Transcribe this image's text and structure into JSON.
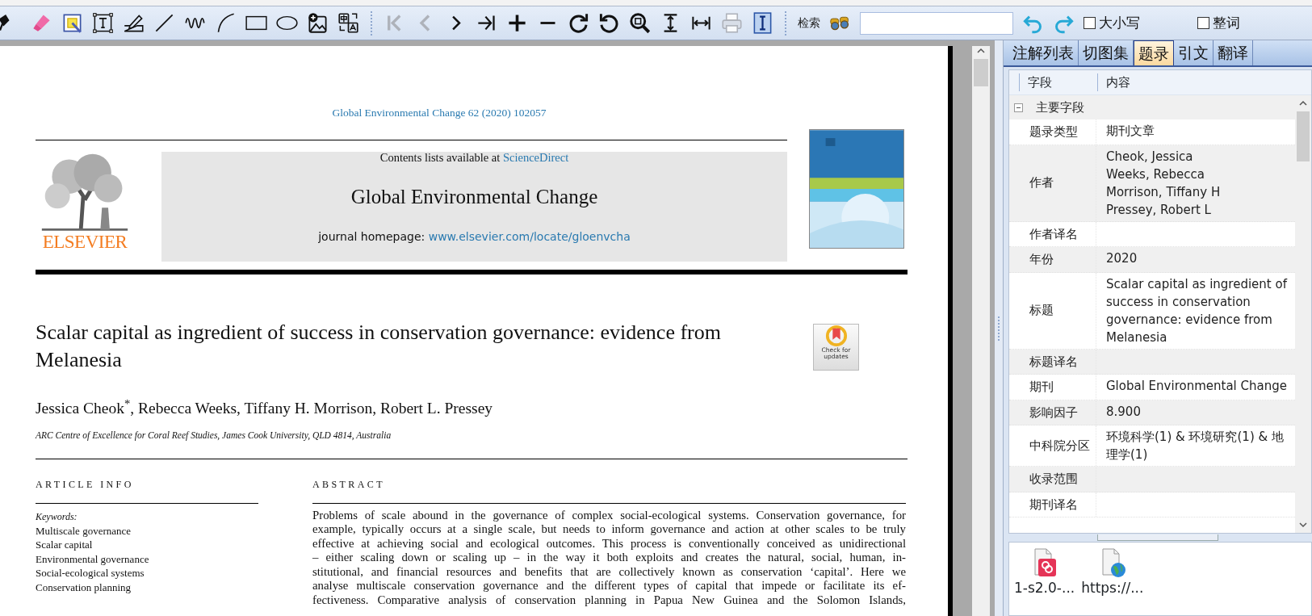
{
  "toolbar": {
    "tools": [
      {
        "kind": "pin",
        "disabled": false
      },
      {
        "kind": "highlighter",
        "disabled": false
      },
      {
        "kind": "note",
        "disabled": false
      },
      {
        "kind": "textbox",
        "disabled": false
      },
      {
        "kind": "signature",
        "disabled": false
      },
      {
        "kind": "line",
        "disabled": false
      },
      {
        "kind": "wave",
        "disabled": false
      },
      {
        "kind": "curve",
        "disabled": false
      },
      {
        "kind": "rect",
        "disabled": false
      },
      {
        "kind": "ellipse",
        "disabled": false
      },
      {
        "kind": "image_add",
        "disabled": false
      },
      {
        "kind": "translate",
        "disabled": false
      },
      {
        "kind": "separator"
      },
      {
        "kind": "first",
        "disabled": true
      },
      {
        "kind": "prev",
        "disabled": true
      },
      {
        "kind": "next",
        "disabled": false
      },
      {
        "kind": "last",
        "disabled": false
      },
      {
        "kind": "zoom_in",
        "disabled": false
      },
      {
        "kind": "zoom_out",
        "disabled": false
      },
      {
        "kind": "rotate_cw",
        "disabled": false
      },
      {
        "kind": "rotate_ccw",
        "disabled": false
      },
      {
        "kind": "zoom_fit",
        "disabled": false
      },
      {
        "kind": "fit_height",
        "disabled": false
      },
      {
        "kind": "fit_width",
        "disabled": false
      },
      {
        "kind": "print",
        "disabled": true
      },
      {
        "kind": "text_select",
        "disabled": false
      },
      {
        "kind": "separator"
      }
    ],
    "search_label": "检索",
    "options": [
      {
        "label": "大小写",
        "checked": false
      },
      {
        "label": "整词",
        "checked": false
      }
    ]
  },
  "document": {
    "citation": "Global Environmental Change 62 (2020) 102057",
    "contents_text": "Contents lists available at",
    "contents_link": "ScienceDirect",
    "journal": "Global Environmental Change",
    "homepage_label": "journal homepage:",
    "homepage_url": "www.elsevier.com/locate/gloenvcha",
    "publisher": "ELSEVIER",
    "badge": "Check for updates",
    "title": "Scalar capital as ingredient of success in conservation governance: evidence from Melanesia",
    "authors": "Jessica Cheok$^{*}$, Rebecca Weeks, Tiffany H. Morrison, Robert L. Pressey",
    "affiliation": "ARC Centre of Excellence for Coral Reef Studies, James Cook University, QLD 4814, Australia",
    "info_heading": "ARTICLE INFO",
    "keywords_label": "Keywords:",
    "keywords": [
      "Multiscale governance",
      "Scalar capital",
      "Environmental governance",
      "Social-ecological systems",
      "Conservation planning"
    ],
    "abstract_heading": "ABSTRACT",
    "abstract_lines": [
      "Problems of scale abound in the governance of complex social-ecological systems. Conservation governance, for",
      "example, typically occurs at a single scale, but needs to inform governance and action at other scales to be truly",
      "effective at achieving social and ecological outcomes. This process is conventionally conceived as unidirectional",
      "– either scaling down or scaling up – in the way it both exploits and creates the natural, social, human, in-",
      "stitutional, and financial resources and benefits that are collectively known as conservation ‘capital’. Here we",
      "analyse multiscale conservation governance and the different types of capital that impede or facilitate its ef-",
      "fectiveness. Comparative analysis of conservation planning in Papua New Guinea and the Solomon Islands,"
    ]
  },
  "panel": {
    "tabs": [
      {
        "label": "注解列表",
        "selected": false
      },
      {
        "label": "切图集",
        "selected": false
      },
      {
        "label": "题录",
        "selected": true
      },
      {
        "label": "引文",
        "selected": false
      },
      {
        "label": "翻译",
        "selected": false
      }
    ],
    "columns": [
      "字段",
      "内容"
    ],
    "groups": [
      {
        "label": "主要字段",
        "expanded": true,
        "rows": [
          {
            "field": "题录类型",
            "value": "期刊文章"
          },
          {
            "field": "作者",
            "value": "Cheok, Jessica\nWeeks, Rebecca\nMorrison, Tiffany H\nPressey, Robert L"
          },
          {
            "field": "作者译名"
          },
          {
            "field": "年份",
            "value": "2020"
          },
          {
            "field": "标题",
            "value": "Scalar capital as ingredient of success in conservation governance: evidence from Melanesia"
          },
          {
            "field": "标题译名"
          },
          {
            "field": "期刊",
            "value": "Global Environmental Change"
          },
          {
            "field": "影响因子",
            "value": "8.900"
          },
          {
            "field": "中科院分区",
            "value": "环境科学(1) & 环境研究(1) & 地理学(1)"
          },
          {
            "field": "收录范围"
          },
          {
            "field": "期刊译名"
          }
        ]
      }
    ],
    "attachments": [
      {
        "name": "1-s2.0-...",
        "kind": "pdf"
      },
      {
        "name": "https://...",
        "kind": "web"
      }
    ]
  }
}
